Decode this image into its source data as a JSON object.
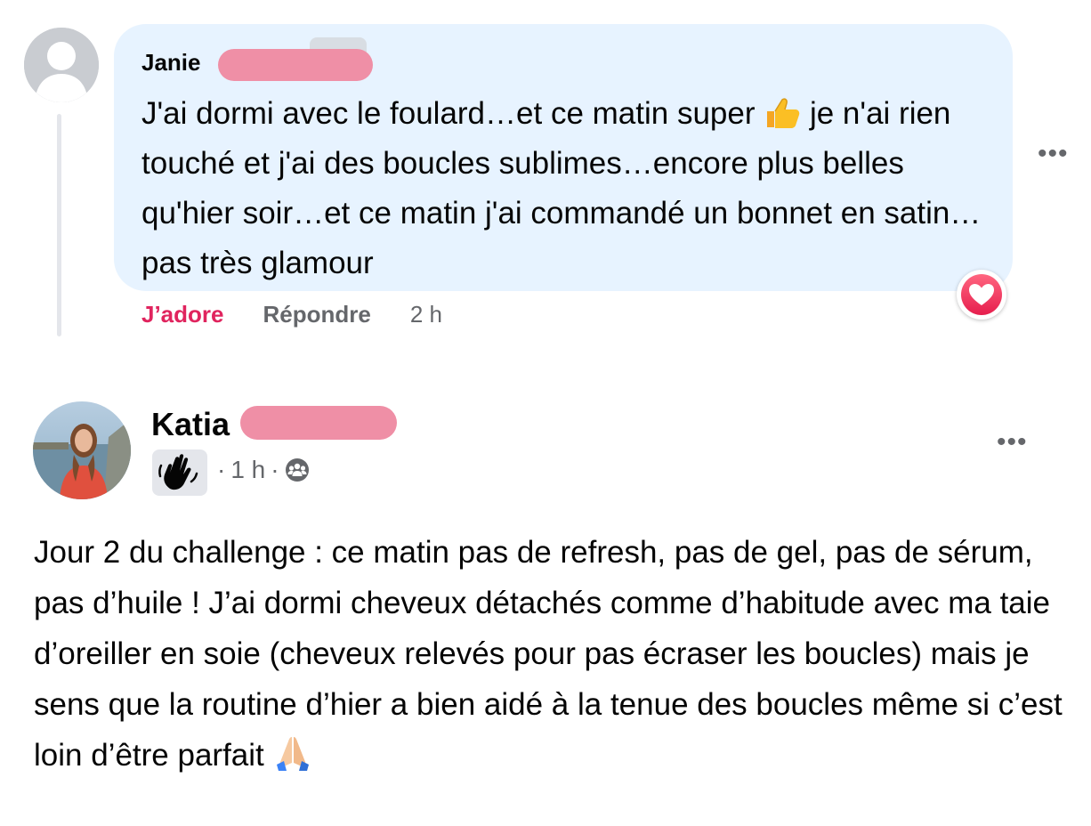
{
  "comment": {
    "author_first_name": "Janie",
    "text": "J'ai dormi avec le foulard…et ce matin super",
    "text_after_emoji": " je n'ai rien touché et j'ai des boucles sublimes…encore plus belles qu'hier soir…et ce matin j'ai commandé un bonnet en satin…pas très glamour",
    "emoji": "thumbs-up",
    "reaction": "love",
    "actions": {
      "love_label": "J’adore",
      "reply_label": "Répondre",
      "time": "2 h"
    }
  },
  "post": {
    "author_first_name": "Katia",
    "badge_icon": "waving-hand-icon",
    "time": "1 h",
    "separator": "·",
    "audience_icon": "group-icon",
    "text": "Jour 2 du challenge : ce matin pas de refresh, pas de gel, pas de sérum, pas d’huile ! J’ai dormi cheveux détachés comme d’habitude avec ma taie d’oreiller en soie (cheveux relevés pour pas écraser les boucles) mais je sens que la routine d’hier a bien aidé à la tenue des boucles même si c’est loin d’être parfait",
    "emoji": "folded-hands"
  },
  "ui": {
    "more_glyph": "•••"
  },
  "colors": {
    "bubble": "#e7f3ff",
    "love": "#e0245e",
    "secondary_text": "#65676b",
    "redaction": "#ef8fa6"
  }
}
